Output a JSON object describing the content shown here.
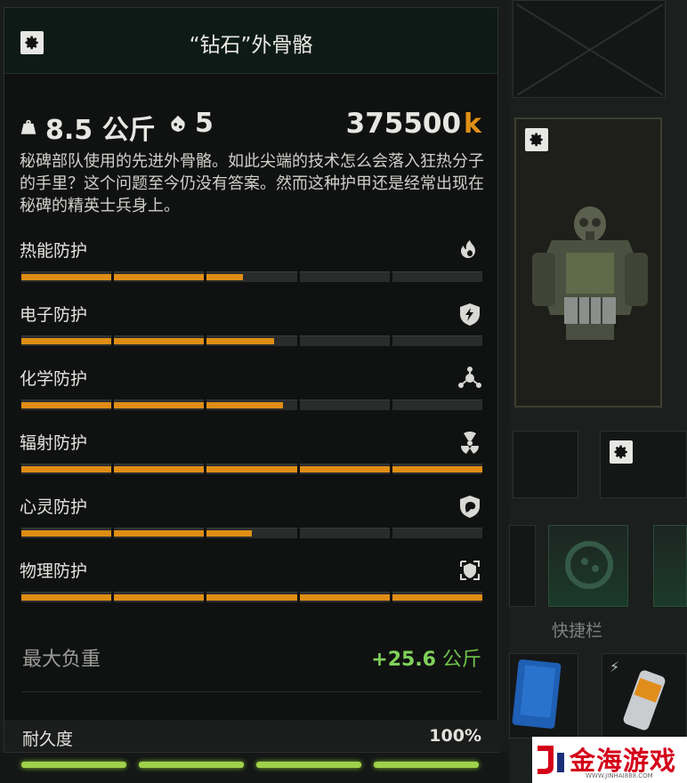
{
  "item": {
    "title": "“钻石”外骨骼",
    "weight": "8.5 公斤",
    "slots": "5",
    "price": "375500",
    "price_currency": "k",
    "description": "秘碑部队使用的先进外骨骼。如此尖端的技术怎么会落入狂热分子的手里？这个问题至今仍没有答案。然而这种护甲还是经常出现在秘碑的精英士兵身上。"
  },
  "protections": [
    {
      "label": "热能防护",
      "icon": "fire-icon",
      "value": 0.48
    },
    {
      "label": "电子防护",
      "icon": "electric-shield-icon",
      "value": 0.55
    },
    {
      "label": "化学防护",
      "icon": "chemical-icon",
      "value": 0.57
    },
    {
      "label": "辐射防护",
      "icon": "radiation-icon",
      "value": 1.0
    },
    {
      "label": "心灵防护",
      "icon": "psy-icon",
      "value": 0.5
    },
    {
      "label": "物理防护",
      "icon": "physical-shield-icon",
      "value": 1.0
    }
  ],
  "max_load": {
    "label": "最大负重",
    "value": "+25.6",
    "unit": "公斤"
  },
  "durability": {
    "label": "耐久度",
    "value": "100%"
  },
  "inventory": {
    "quickbar_label": "快捷栏"
  },
  "watermark": {
    "brand": "金海游戏",
    "url": "WWW.JINHAI888.COM"
  },
  "colors": {
    "accent": "#df8d15",
    "positive": "#7fd15a",
    "panel": "#101111"
  }
}
